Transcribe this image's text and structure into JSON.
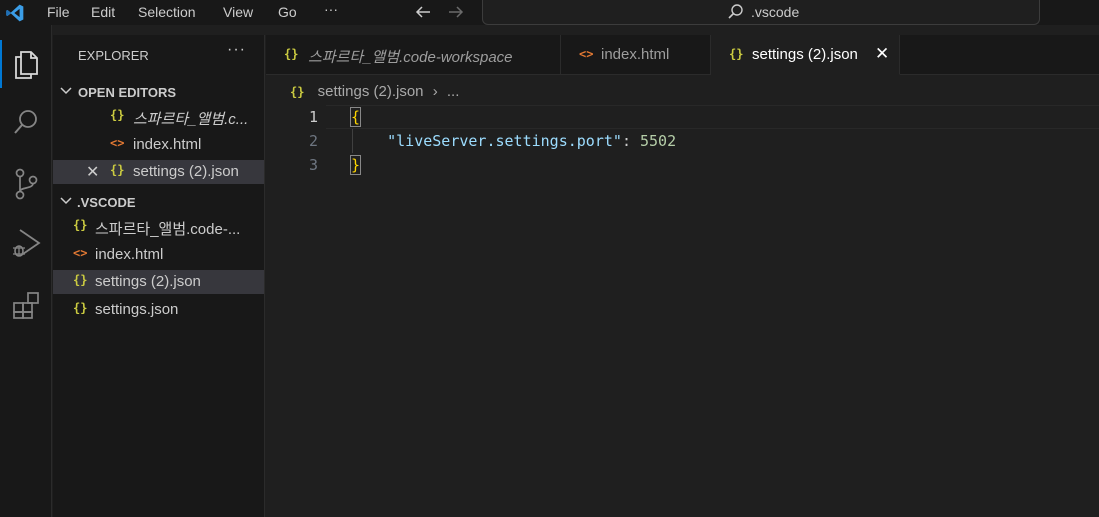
{
  "menu": {
    "file": "File",
    "edit": "Edit",
    "selection": "Selection",
    "view": "View",
    "go": "Go",
    "more": "···"
  },
  "command_center": {
    "text": ".vscode"
  },
  "explorer": {
    "title": "EXPLORER",
    "more": "···",
    "open_editors": {
      "title": "OPEN EDITORS",
      "items": [
        {
          "icon": "{}",
          "label": "스파르타_앨범.c..."
        },
        {
          "icon": "<>",
          "label": "index.html"
        },
        {
          "icon": "{}",
          "label": "settings (2).json",
          "close": "✕"
        }
      ]
    },
    "folder": {
      "title": ".VSCODE",
      "items": [
        {
          "icon": "{}",
          "label": "스파르타_앨범.code-..."
        },
        {
          "icon": "<>",
          "label": "index.html"
        },
        {
          "icon": "{}",
          "label": "settings (2).json"
        },
        {
          "icon": "{}",
          "label": "settings.json"
        }
      ]
    }
  },
  "tabs": [
    {
      "icon": "{}",
      "label": "스파르타_앨범.code-workspace"
    },
    {
      "icon": "<>",
      "label": "index.html"
    },
    {
      "icon": "{}",
      "label": "settings (2).json",
      "close": "✕"
    }
  ],
  "breadcrumb": {
    "icon": "{}",
    "file": "settings (2).json",
    "sep": "›",
    "more": "..."
  },
  "editor": {
    "line_numbers": [
      "1",
      "2",
      "3"
    ],
    "line1": "{",
    "line2_indent": "    ",
    "line2_key": "\"liveServer.settings.port\"",
    "line2_colon": ": ",
    "line2_value": "5502",
    "line3": "}"
  },
  "colors": {
    "accent": "#0078d4",
    "json_icon": "#cbcb41",
    "html_icon": "#e37933",
    "brace": "#ffd700",
    "key": "#9cdcfe",
    "number": "#b5cea8"
  }
}
